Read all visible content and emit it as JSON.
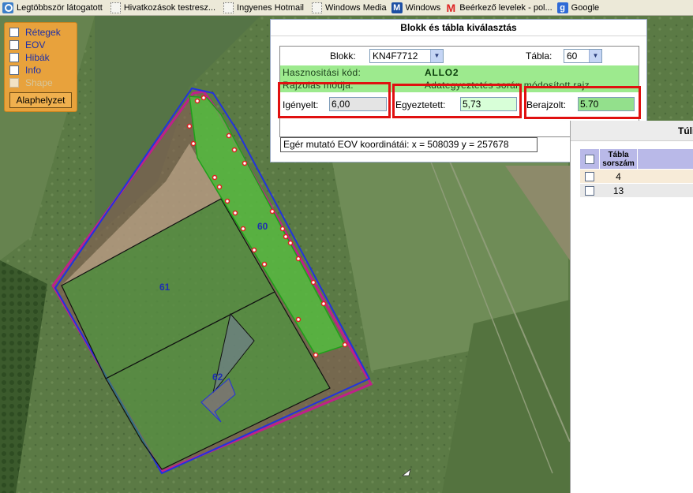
{
  "bookmarks": [
    {
      "label": "Legtöbbször látogatott",
      "icon": "search-icon"
    },
    {
      "label": "Hivatkozások testresz...",
      "icon": "page-icon"
    },
    {
      "label": "Ingyenes Hotmail",
      "icon": "page-icon"
    },
    {
      "label": "Windows Media",
      "icon": "page-icon"
    },
    {
      "label": "Windows",
      "icon": "windows-icon"
    },
    {
      "label": "Beérkező levelek - pol...",
      "icon": "gmail-icon"
    },
    {
      "label": "Google",
      "icon": "google-icon"
    }
  ],
  "layers": {
    "items": [
      {
        "label": "Rétegek",
        "checked": false,
        "disabled": false
      },
      {
        "label": "EOV",
        "checked": false,
        "disabled": false
      },
      {
        "label": "Hibák",
        "checked": false,
        "disabled": false
      },
      {
        "label": "Info",
        "checked": false,
        "disabled": false
      },
      {
        "label": "Shape",
        "checked": false,
        "disabled": true
      }
    ],
    "reset_label": "Alaphelyzet"
  },
  "dialog": {
    "title": "Blokk és tábla kiválasztás",
    "blokk_label": "Blokk:",
    "blokk_value": "KN4F7712",
    "tabla_label": "Tábla:",
    "tabla_value": "60",
    "hasznositasi_label": "Hasznositási kód:",
    "hasznositasi_value": "ALLO2",
    "rajzolas_label": "Rajzolás módja:",
    "rajzolas_value": "Adategyeztetés során módosított rajz",
    "igenyelt_label": "Igényelt:",
    "igenyelt_value": "6,00",
    "egyeztetett_label": "Egyeztetett:",
    "egyeztetett_value": "5,73",
    "berajzolt_label": "Berajzolt:",
    "berajzolt_value": "5.70",
    "coord_text": "Egér mutató EOV koordinátái: x = 508039  y = 257678"
  },
  "map": {
    "parcel_labels": [
      "60",
      "61",
      "62"
    ]
  },
  "right_panel": {
    "title": "Túli",
    "column_header_line1": "Tábla",
    "column_header_line2": "sorszám",
    "rows": [
      "4",
      "13"
    ]
  },
  "colors": {
    "parcel_fill": "#3fa63a",
    "block_outline": "#2233dd",
    "boundary_magenta": "#c0208a",
    "highlight_red": "#e01010",
    "layer_panel": "#e8a23c"
  }
}
